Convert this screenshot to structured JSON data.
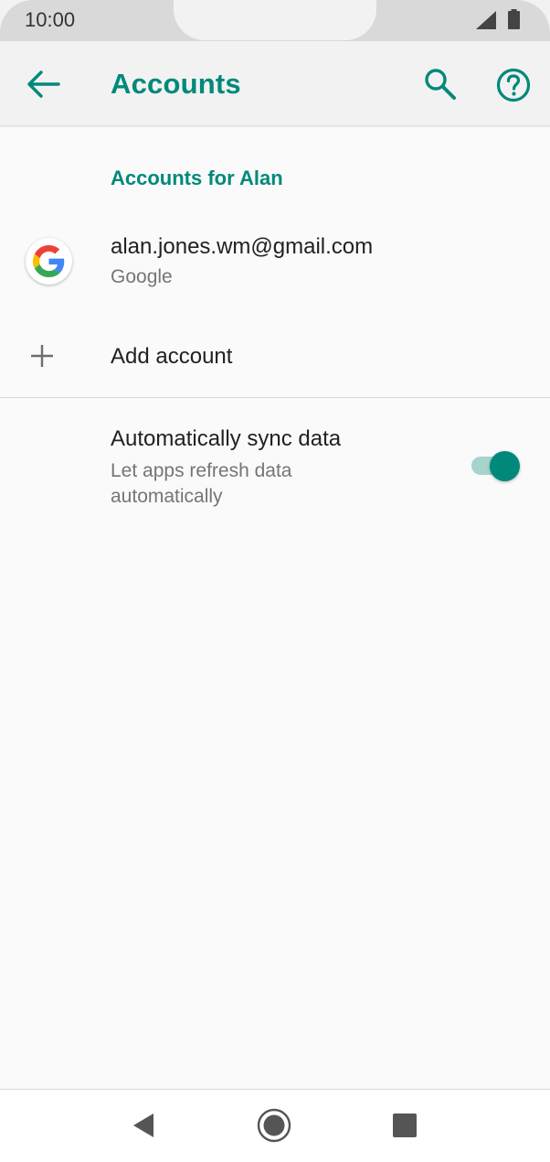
{
  "status_bar": {
    "time": "10:00"
  },
  "app_bar": {
    "title": "Accounts",
    "accent_color": "#00897b"
  },
  "accounts_section": {
    "header": "Accounts for Alan",
    "accounts": [
      {
        "email": "alan.jones.wm@gmail.com",
        "type": "Google",
        "icon": "google-logo-icon"
      }
    ],
    "add_account_label": "Add account"
  },
  "sync": {
    "title": "Automatically sync data",
    "summary": "Let apps refresh data automatically",
    "enabled": true
  },
  "nav_bar": {
    "icons": [
      "back-triangle-icon",
      "home-circle-icon",
      "recents-square-icon"
    ]
  }
}
